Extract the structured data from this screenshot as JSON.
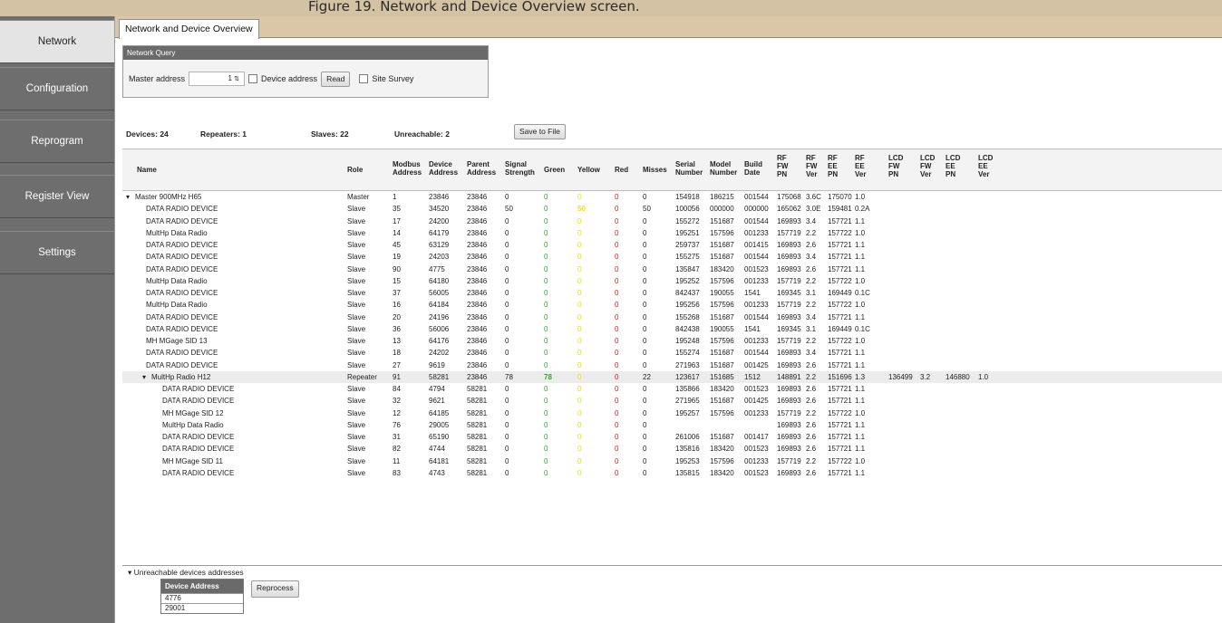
{
  "caption_text": "Figure 19. Network and Device Overview screen.",
  "sidebar": {
    "items": [
      {
        "label": "Network",
        "active": true
      },
      {
        "label": "Configuration",
        "active": false
      },
      {
        "label": "Reprogram",
        "active": false
      },
      {
        "label": "Register View",
        "active": false
      },
      {
        "label": "Settings",
        "active": false
      }
    ]
  },
  "tab": {
    "label": "Network and Device Overview"
  },
  "query": {
    "title": "Network Query",
    "master_label": "Master address",
    "master_value": "1",
    "device_address_label": "Device address",
    "read_label": "Read",
    "site_survey_label": "Site Survey"
  },
  "stats": {
    "devices": "Devices: 24",
    "repeaters": "Repeaters: 1",
    "slaves": "Slaves: 22",
    "unreachable": "Unreachable: 2",
    "save_label": "Save to File"
  },
  "grid": {
    "columns": [
      "Name",
      "Role",
      "Modbus\nAddress",
      "Device\nAddress",
      "Parent\nAddress",
      "Signal\nStrength",
      "Green",
      "Yellow",
      "Red",
      "Misses",
      "Serial\nNumber",
      "Model\nNumber",
      "Build\nDate",
      "RF\nFW\nPN",
      "RF\nFW\nVer",
      "RF\nEE\nPN",
      "RF\nEE\nVer",
      "LCD\nFW\nPN",
      "LCD\nFW\nVer",
      "LCD\nEE\nPN",
      "LCD\nEE\nVer"
    ],
    "rows": [
      [
        "Master 900MHz H65",
        "Master",
        "1",
        "23846",
        "23846",
        "0",
        "0",
        "0",
        "0",
        "0",
        "154918",
        "186215",
        "001544",
        "175068",
        "3.6C",
        "175070",
        "1.0",
        "",
        "",
        "",
        ""
      ],
      [
        "DATA RADIO DEVICE",
        "Slave",
        "35",
        "34520",
        "23846",
        "50",
        "0",
        "50",
        "0",
        "50",
        "100056",
        "000000",
        "000000",
        "165062",
        "3.0E",
        "159481",
        "0.2A",
        "",
        "",
        "",
        ""
      ],
      [
        "DATA RADIO DEVICE",
        "Slave",
        "17",
        "24200",
        "23846",
        "0",
        "0",
        "0",
        "0",
        "0",
        "155272",
        "151687",
        "001544",
        "169893",
        "3.4",
        "157721",
        "1.1",
        "",
        "",
        "",
        ""
      ],
      [
        "MultHp Data Radio",
        "Slave",
        "14",
        "64179",
        "23846",
        "0",
        "0",
        "0",
        "0",
        "0",
        "195251",
        "157596",
        "001233",
        "157719",
        "2.2",
        "157722",
        "1.0",
        "",
        "",
        "",
        ""
      ],
      [
        "DATA RADIO DEVICE",
        "Slave",
        "45",
        "63129",
        "23846",
        "0",
        "0",
        "0",
        "0",
        "0",
        "259737",
        "151687",
        "001415",
        "169893",
        "2.6",
        "157721",
        "1.1",
        "",
        "",
        "",
        ""
      ],
      [
        "DATA RADIO DEVICE",
        "Slave",
        "19",
        "24203",
        "23846",
        "0",
        "0",
        "0",
        "0",
        "0",
        "155275",
        "151687",
        "001544",
        "169893",
        "3.4",
        "157721",
        "1.1",
        "",
        "",
        "",
        ""
      ],
      [
        "DATA RADIO DEVICE",
        "Slave",
        "90",
        "4775",
        "23846",
        "0",
        "0",
        "0",
        "0",
        "0",
        "135847",
        "183420",
        "001523",
        "169893",
        "2.6",
        "157721",
        "1.1",
        "",
        "",
        "",
        ""
      ],
      [
        "MultHp Data Radio",
        "Slave",
        "15",
        "64180",
        "23846",
        "0",
        "0",
        "0",
        "0",
        "0",
        "195252",
        "157596",
        "001233",
        "157719",
        "2.2",
        "157722",
        "1.0",
        "",
        "",
        "",
        ""
      ],
      [
        "DATA RADIO DEVICE",
        "Slave",
        "37",
        "56005",
        "23846",
        "0",
        "0",
        "0",
        "0",
        "0",
        "842437",
        "190055",
        "1541",
        "169345",
        "3.1",
        "169449",
        "0.1C",
        "",
        "",
        "",
        ""
      ],
      [
        "MultHp Data Radio",
        "Slave",
        "16",
        "64184",
        "23846",
        "0",
        "0",
        "0",
        "0",
        "0",
        "195256",
        "157596",
        "001233",
        "157719",
        "2.2",
        "157722",
        "1.0",
        "",
        "",
        "",
        ""
      ],
      [
        "DATA RADIO DEVICE",
        "Slave",
        "20",
        "24196",
        "23846",
        "0",
        "0",
        "0",
        "0",
        "0",
        "155268",
        "151687",
        "001544",
        "169893",
        "3.4",
        "157721",
        "1.1",
        "",
        "",
        "",
        ""
      ],
      [
        "DATA RADIO DEVICE",
        "Slave",
        "36",
        "56006",
        "23846",
        "0",
        "0",
        "0",
        "0",
        "0",
        "842438",
        "190055",
        "1541",
        "169345",
        "3.1",
        "169449",
        "0.1C",
        "",
        "",
        "",
        ""
      ],
      [
        "MH MGage SID 13",
        "Slave",
        "13",
        "64176",
        "23846",
        "0",
        "0",
        "0",
        "0",
        "0",
        "195248",
        "157596",
        "001233",
        "157719",
        "2.2",
        "157722",
        "1.0",
        "",
        "",
        "",
        ""
      ],
      [
        "DATA RADIO DEVICE",
        "Slave",
        "18",
        "24202",
        "23846",
        "0",
        "0",
        "0",
        "0",
        "0",
        "155274",
        "151687",
        "001544",
        "169893",
        "3.4",
        "157721",
        "1.1",
        "",
        "",
        "",
        ""
      ],
      [
        "DATA RADIO DEVICE",
        "Slave",
        "27",
        "9619",
        "23846",
        "0",
        "0",
        "0",
        "0",
        "0",
        "271963",
        "151687",
        "001425",
        "169893",
        "2.6",
        "157721",
        "1.1",
        "",
        "",
        "",
        ""
      ],
      [
        "MultHp Radio H12",
        "Repeater",
        "91",
        "58281",
        "23846",
        "78",
        "78",
        "0",
        "0",
        "22",
        "123617",
        "151685",
        "1512",
        "148891",
        "2.2",
        "151696",
        "1.3",
        "136499",
        "3.2",
        "146880",
        "1.0"
      ],
      [
        "DATA RADIO DEVICE",
        "Slave",
        "84",
        "4794",
        "58281",
        "0",
        "0",
        "0",
        "0",
        "0",
        "135866",
        "183420",
        "001523",
        "169893",
        "2.6",
        "157721",
        "1.1",
        "",
        "",
        "",
        ""
      ],
      [
        "DATA RADIO DEVICE",
        "Slave",
        "32",
        "9621",
        "58281",
        "0",
        "0",
        "0",
        "0",
        "0",
        "271965",
        "151687",
        "001425",
        "169893",
        "2.6",
        "157721",
        "1.1",
        "",
        "",
        "",
        ""
      ],
      [
        "MH MGage SID 12",
        "Slave",
        "12",
        "64185",
        "58281",
        "0",
        "0",
        "0",
        "0",
        "0",
        "195257",
        "157596",
        "001233",
        "157719",
        "2.2",
        "157722",
        "1.0",
        "",
        "",
        "",
        ""
      ],
      [
        "MultHp Data Radio",
        "Slave",
        "76",
        "29005",
        "58281",
        "0",
        "0",
        "0",
        "0",
        "0",
        "",
        "",
        "",
        "169893",
        "2.6",
        "157721",
        "1.1",
        "",
        "",
        "",
        ""
      ],
      [
        "DATA RADIO DEVICE",
        "Slave",
        "31",
        "65190",
        "58281",
        "0",
        "0",
        "0",
        "0",
        "0",
        "261006",
        "151687",
        "001417",
        "169893",
        "2.6",
        "157721",
        "1.1",
        "",
        "",
        "",
        ""
      ],
      [
        "DATA RADIO DEVICE",
        "Slave",
        "82",
        "4744",
        "58281",
        "0",
        "0",
        "0",
        "0",
        "0",
        "135816",
        "183420",
        "001523",
        "169893",
        "2.6",
        "157721",
        "1.1",
        "",
        "",
        "",
        ""
      ],
      [
        "MH MGage SID 11",
        "Slave",
        "11",
        "64181",
        "58281",
        "0",
        "0",
        "0",
        "0",
        "0",
        "195253",
        "157596",
        "001233",
        "157719",
        "2.2",
        "157722",
        "1.0",
        "",
        "",
        "",
        ""
      ],
      [
        "DATA RADIO DEVICE",
        "Slave",
        "83",
        "4743",
        "58281",
        "0",
        "0",
        "0",
        "0",
        "0",
        "135815",
        "183420",
        "001523",
        "169893",
        "2.6",
        "157721",
        "1.1",
        "",
        "",
        "",
        ""
      ]
    ]
  },
  "unreachable": {
    "title": "Unreachable devices addresses",
    "header": "Device Address",
    "addresses": [
      "4776",
      "29001"
    ],
    "reprocess_label": "Reprocess"
  },
  "colors": {
    "sidebar": "#6e6e6e",
    "tabstrip": "#d9c7a8",
    "green": "#2ea82e",
    "yellow": "#f0e000",
    "red": "#d42020"
  }
}
